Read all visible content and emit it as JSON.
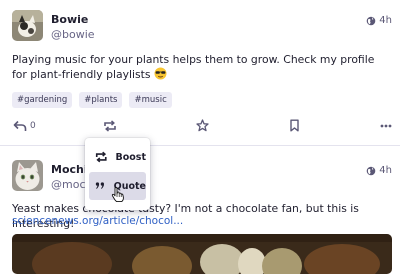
{
  "posts": [
    {
      "display_name": "Bowie",
      "handle": "@bowie",
      "time": "4h",
      "text": "Playing music for your plants helps them to grow. Check my profile for plant-friendly playlists",
      "tags": [
        "#gardening",
        "#plants",
        "#music"
      ],
      "reply_count": "0"
    },
    {
      "display_name": "Mochi",
      "handle": "@moc",
      "time": "4h",
      "text": "Yeast makes chocolate tasty? I'm not a chocolate fan, but this is interesting!",
      "link": "sciencenews.org/article/chocol..."
    }
  ],
  "boost_menu": {
    "items": [
      {
        "label": "Boost",
        "icon": "boost-icon"
      },
      {
        "label": "Quote",
        "icon": "quote-icon"
      }
    ]
  },
  "colors": {
    "text": "#1f1e2e",
    "muted": "#5b5876",
    "tag_bg": "#ecebf5",
    "link": "#2e5fc4",
    "menu_hover": "#dcdbe8"
  }
}
